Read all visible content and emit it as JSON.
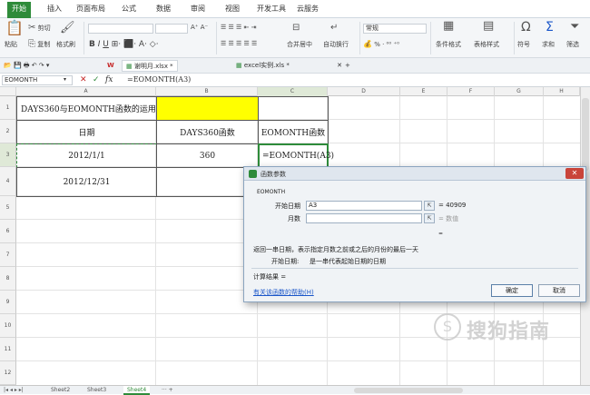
{
  "menu": {
    "tabs": [
      "开始",
      "插入",
      "页面布局",
      "公式",
      "数据",
      "审阅",
      "视图",
      "开发工具",
      "云服务"
    ],
    "active_index": 0
  },
  "ribbon": {
    "paste": "粘贴",
    "cut": "剪切",
    "copy": "复制",
    "format_painter": "格式刷",
    "font_name": "",
    "font_size": "",
    "merge_center": "合并居中",
    "auto_wrap": "自动换行",
    "number_format": "常规",
    "percent": "% ·",
    "cond_format": "条件格式",
    "table_style": "表格样式",
    "symbol": "符号",
    "sum": "求和",
    "filter": "筛选"
  },
  "files": {
    "tab1": "谢明月.xlsx *",
    "tab2": "excel实例.xls *"
  },
  "formula_bar": {
    "name_box": "EOMONTH",
    "fx": "fx",
    "formula": "=EOMONTH(A3)"
  },
  "columns": [
    "A",
    "B",
    "C",
    "D",
    "E",
    "F",
    "G",
    "H"
  ],
  "rows": [
    "1",
    "2",
    "3",
    "4",
    "5",
    "6",
    "7",
    "8",
    "9",
    "10",
    "11",
    "12"
  ],
  "cells": {
    "a1": "DAYS360与EOMONTH函数的运用",
    "a2": "日期",
    "b2": "DAYS360函数",
    "c2": "EOMONTH函数",
    "a3": "2012/1/1",
    "b3": "360",
    "c3": "=EOMONTH(A3)",
    "a4": "2012/12/31"
  },
  "colors": {
    "accent": "#2e8b3a",
    "highlight": "#ffff00",
    "dialog_link": "#1a56c9"
  },
  "dialog": {
    "title": "函数参数",
    "func_name": "EOMONTH",
    "arg1_label": "开始日期",
    "arg1_value": "A3",
    "arg1_result": "= 40909",
    "arg2_label": "月数",
    "arg2_value": "",
    "arg2_result": "= 数值",
    "equals_line": "=",
    "description": "返回一串日期，表示指定月数之前或之后的月份的最后一天",
    "param_desc_label": "开始日期:",
    "param_desc": "是一串代表起始日期的日期",
    "calc_result": "计算结果 =",
    "help_link": "有关该函数的帮助(H)",
    "ok": "确定",
    "cancel": "取消"
  },
  "sheets": [
    "Sheet2",
    "Sheet3",
    "Sheet4"
  ],
  "active_sheet": 2,
  "watermark": "搜狗指南"
}
